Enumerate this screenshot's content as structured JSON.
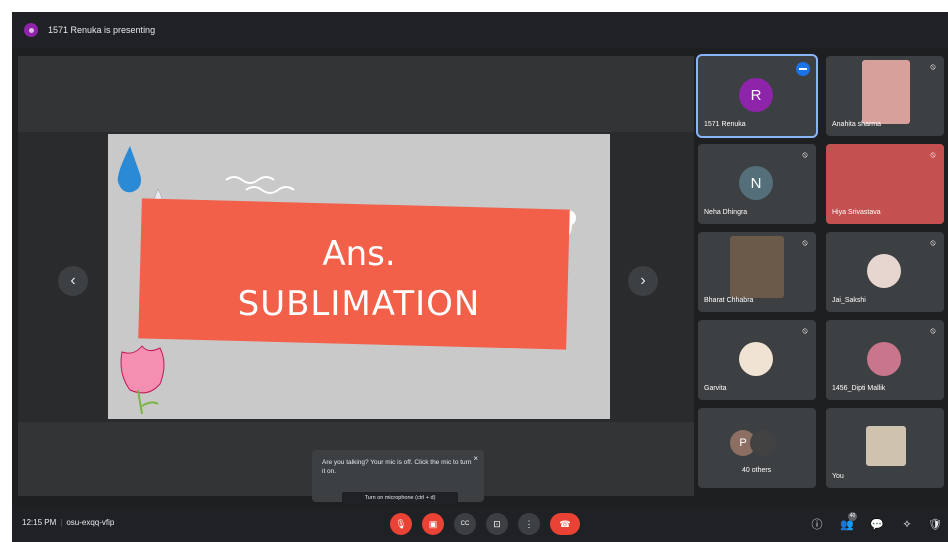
{
  "presenting_banner": "1571 Renuka is presenting",
  "slide": {
    "line1": "Ans.",
    "line2": "SUBLIMATION"
  },
  "participants": [
    {
      "name": "1571 Renuka",
      "initial": "R",
      "color": "#8e24aa"
    },
    {
      "name": "Anahita sharma",
      "initial": "",
      "color": "#d8a09a"
    },
    {
      "name": "Neha Dhingra",
      "initial": "N",
      "color": "#546e7a"
    },
    {
      "name": "Hiya Srivastava",
      "initial": "",
      "color": "#c4504f"
    },
    {
      "name": "Bharat Chhabra",
      "initial": "",
      "color": "#6b5a4a"
    },
    {
      "name": "Jai_Sakshi",
      "initial": "",
      "color": "#e6d6cf"
    },
    {
      "name": "Garvita",
      "initial": "",
      "color": "#f1e3d3"
    },
    {
      "name": "1456_Dipti Mallik",
      "initial": "",
      "color": "#c9758c"
    },
    {
      "name": "40 others",
      "initial": "P",
      "color": "#8d6e63"
    },
    {
      "name": "You",
      "initial": "",
      "color": "#cfc3b0"
    }
  ],
  "toast": {
    "text": "Are you talking? Your mic is off. Click the mic to turn it on.",
    "close": "×",
    "tooltip": "Turn on microphone (ctrl + d)"
  },
  "bottom": {
    "time": "12:15 PM",
    "separator": "|",
    "meeting_code": "osu-exqq-vfip"
  },
  "controls": {
    "prev": "‹",
    "next": "›",
    "mic": "🎙",
    "camera": "▣",
    "captions": "CC",
    "present": "⊡",
    "more": "⋮",
    "hangup": "☎",
    "info": "ⓘ",
    "people": "👥",
    "people_count": "40",
    "chat": "💬",
    "activities": "⟡",
    "security": "🛡"
  },
  "colors": {
    "accent": "#1a73e8",
    "hangup": "#ea4335",
    "banner": "#f2604a"
  }
}
